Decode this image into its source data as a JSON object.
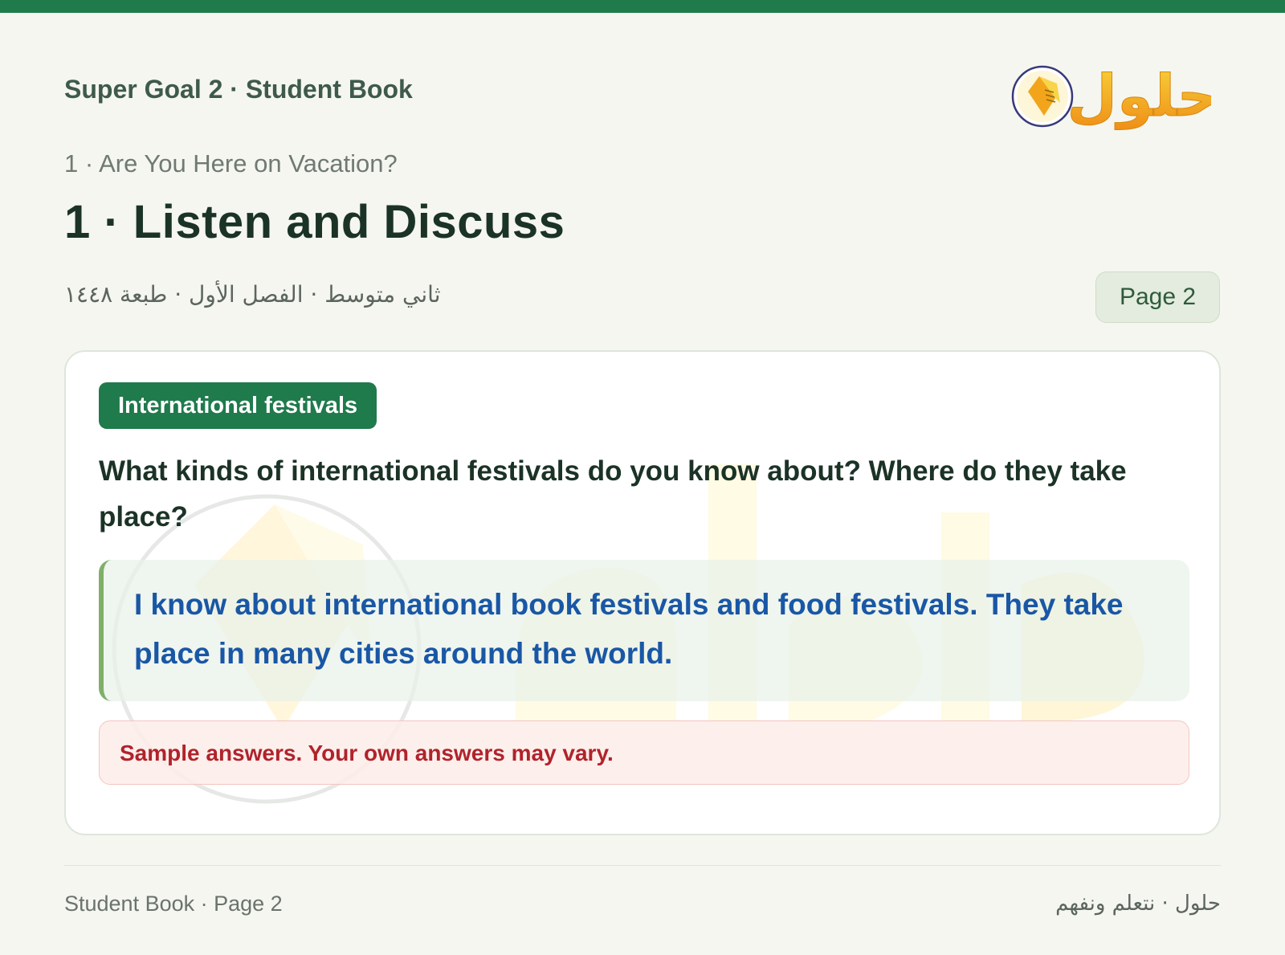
{
  "header": {
    "book_title": "Super Goal 2 · Student Book",
    "logo_text": "حلول"
  },
  "lesson": {
    "unit_line": "1 · Are You Here on Vacation?",
    "title": "1 · Listen and Discuss",
    "grade_line": "ثاني متوسط · الفصل الأول · طبعة ١٤٤٨",
    "page_badge": "Page 2"
  },
  "card": {
    "tag": "International festivals",
    "question": "What kinds of international festivals do you know about? Where do they take place?",
    "answer": "I know about international book festivals and food festivals. They take place in many cities around the world.",
    "note": "Sample answers. Your own answers may vary."
  },
  "footer": {
    "left": "Student Book · Page 2",
    "right": "حلول · نتعلم ونفهم"
  },
  "colors": {
    "brand_green": "#1f7a4c",
    "answer_blue": "#1957a6",
    "note_red": "#b0232b",
    "logo_orange": "#f3a51c"
  },
  "icons": {
    "logo": "book-circle-icon"
  }
}
